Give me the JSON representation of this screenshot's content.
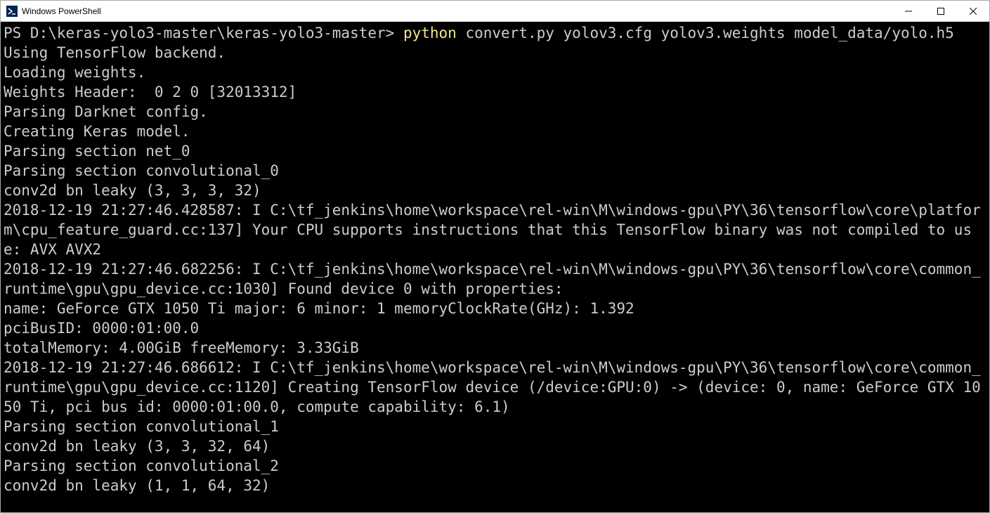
{
  "window": {
    "title": "Windows PowerShell"
  },
  "prompt": {
    "path": "PS D:\\keras-yolo3-master\\keras-yolo3-master> ",
    "command": "python",
    "args": " convert.py yolov3.cfg yolov3.weights model_data/yolo.h5"
  },
  "output": {
    "l1": "Using TensorFlow backend.",
    "l2": "Loading weights.",
    "l3": "Weights Header:  0 2 0 [32013312]",
    "l4": "Parsing Darknet config.",
    "l5": "Creating Keras model.",
    "l6": "Parsing section net_0",
    "l7": "Parsing section convolutional_0",
    "l8": "conv2d bn leaky (3, 3, 3, 32)",
    "l9": "2018-12-19 21:27:46.428587: I C:\\tf_jenkins\\home\\workspace\\rel-win\\M\\windows-gpu\\PY\\36\\tensorflow\\core\\platform\\cpu_feature_guard.cc:137] Your CPU supports instructions that this TensorFlow binary was not compiled to use: AVX AVX2",
    "l10": "2018-12-19 21:27:46.682256: I C:\\tf_jenkins\\home\\workspace\\rel-win\\M\\windows-gpu\\PY\\36\\tensorflow\\core\\common_runtime\\gpu\\gpu_device.cc:1030] Found device 0 with properties:",
    "l11": "name: GeForce GTX 1050 Ti major: 6 minor: 1 memoryClockRate(GHz): 1.392",
    "l12": "pciBusID: 0000:01:00.0",
    "l13": "totalMemory: 4.00GiB freeMemory: 3.33GiB",
    "l14": "2018-12-19 21:27:46.686612: I C:\\tf_jenkins\\home\\workspace\\rel-win\\M\\windows-gpu\\PY\\36\\tensorflow\\core\\common_runtime\\gpu\\gpu_device.cc:1120] Creating TensorFlow device (/device:GPU:0) -> (device: 0, name: GeForce GTX 1050 Ti, pci bus id: 0000:01:00.0, compute capability: 6.1)",
    "l15": "Parsing section convolutional_1",
    "l16": "conv2d bn leaky (3, 3, 32, 64)",
    "l17": "Parsing section convolutional_2",
    "l18": "conv2d bn leaky (1, 1, 64, 32)"
  }
}
